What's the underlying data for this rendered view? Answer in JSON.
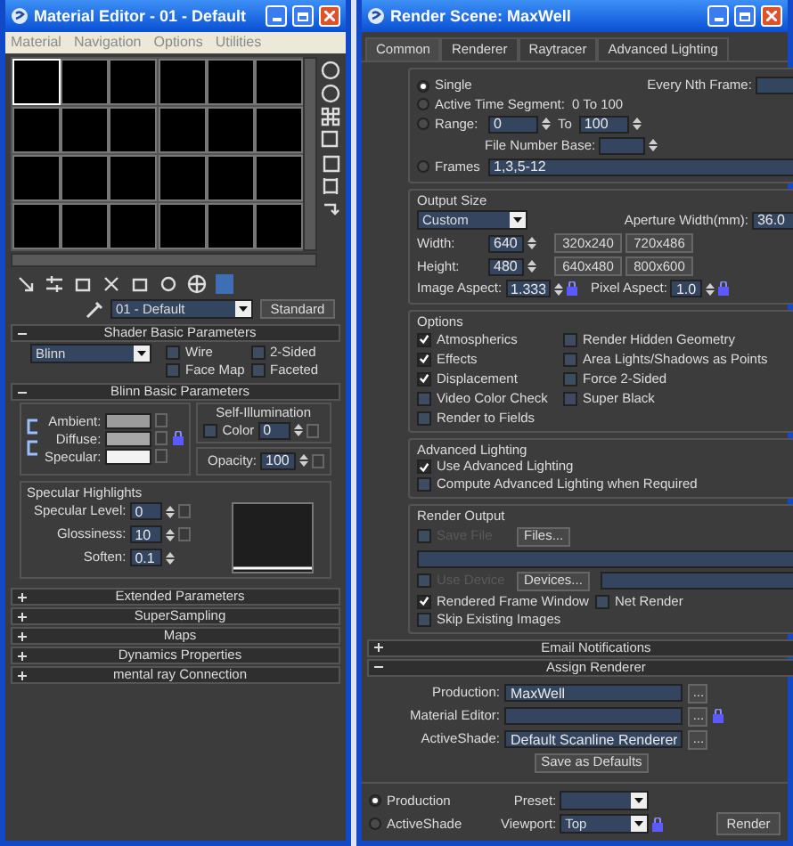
{
  "material_editor": {
    "title": "Material Editor - 01 - Default",
    "menu": [
      "Material",
      "Navigation",
      "Options",
      "Utilities"
    ],
    "slots": [
      {
        "selected": true
      },
      {
        "selected": false
      },
      {
        "selected": false
      },
      {
        "selected": false
      },
      {
        "selected": false
      },
      {
        "selected": false
      },
      {
        "selected": false
      },
      {
        "selected": false
      },
      {
        "selected": false
      },
      {
        "selected": false
      },
      {
        "selected": false
      },
      {
        "selected": false
      },
      {
        "selected": false
      },
      {
        "selected": false
      },
      {
        "selected": false
      },
      {
        "selected": false
      },
      {
        "selected": false
      },
      {
        "selected": false
      },
      {
        "selected": false
      },
      {
        "selected": false
      },
      {
        "selected": false
      },
      {
        "selected": false
      },
      {
        "selected": false
      },
      {
        "selected": false
      }
    ],
    "material_name": "01 - Default",
    "material_type": "Standard",
    "shader_rollout": {
      "title": "Shader Basic Parameters",
      "expanded": true,
      "shader": "Blinn",
      "options": [
        {
          "label": "Wire",
          "checked": false
        },
        {
          "label": "2-Sided",
          "checked": false
        },
        {
          "label": "Face Map",
          "checked": false
        },
        {
          "label": "Faceted",
          "checked": false
        }
      ]
    },
    "blinn_rollout": {
      "title": "Blinn Basic Parameters",
      "expanded": true,
      "colors": [
        {
          "label": "Ambient:",
          "color": "#9c9c9c"
        },
        {
          "label": "Diffuse:",
          "color": "#a6a6a6"
        },
        {
          "label": "Specular:",
          "color": "#f2f2f2"
        }
      ],
      "self_illumination": {
        "title": "Self-Illumination",
        "label": "Color",
        "value": "0",
        "checked": false
      },
      "opacity": {
        "label": "Opacity:",
        "value": "100"
      },
      "specular_highlights": {
        "title": "Specular Highlights",
        "fields": [
          {
            "label": "Specular Level:",
            "value": "0"
          },
          {
            "label": "Glossiness:",
            "value": "10"
          },
          {
            "label": "Soften:",
            "value": "0.1"
          }
        ]
      }
    },
    "collapsed_rollouts": [
      {
        "title": "Extended Parameters",
        "expanded": false
      },
      {
        "title": "SuperSampling",
        "expanded": false
      },
      {
        "title": "Maps",
        "expanded": false
      },
      {
        "title": "Dynamics Properties",
        "expanded": false
      },
      {
        "title": "mental ray Connection",
        "expanded": false
      }
    ]
  },
  "render_scene": {
    "title": "Render Scene: MaxWell",
    "tabs": [
      {
        "label": "Common",
        "selected": true
      },
      {
        "label": "Renderer",
        "selected": false
      },
      {
        "label": "Raytracer",
        "selected": false
      },
      {
        "label": "Advanced Lighting",
        "selected": false
      }
    ],
    "time_output": {
      "modes": [
        {
          "label": "Single",
          "selected": true
        },
        {
          "label": "Active Time Segment:",
          "selected": false
        },
        {
          "label": "Range:",
          "selected": false
        },
        {
          "label": "Frames",
          "selected": false
        }
      ],
      "every_nth_frame": {
        "label": "Every Nth Frame:"
      },
      "active_time_segment": "0 To 100",
      "range": {
        "from": "0",
        "to_label": "To",
        "to": "100"
      },
      "file_number_base": {
        "label": "File Number Base:"
      },
      "frames": "1,3,5-12"
    },
    "output_size": {
      "title": "Output Size",
      "preset": "Custom",
      "aperture": {
        "label": "Aperture Width(mm):",
        "value": "36.0"
      },
      "width": {
        "label": "Width:",
        "value": "640"
      },
      "height": {
        "label": "Height:",
        "value": "480"
      },
      "presets": [
        "320x240",
        "720x486",
        "640x480",
        "800x600"
      ],
      "image_aspect": {
        "label": "Image Aspect:",
        "value": "1.333"
      },
      "pixel_aspect": {
        "label": "Pixel Aspect:",
        "value": "1.0"
      }
    },
    "options": {
      "title": "Options",
      "items": [
        {
          "label": "Atmospherics",
          "checked": true
        },
        {
          "label": "Render Hidden Geometry",
          "checked": false
        },
        {
          "label": "Effects",
          "checked": true
        },
        {
          "label": "Area Lights/Shadows as Points",
          "checked": false
        },
        {
          "label": "Displacement",
          "checked": true
        },
        {
          "label": "Force 2-Sided",
          "checked": false
        },
        {
          "label": "Video Color Check",
          "checked": false
        },
        {
          "label": "Super Black",
          "checked": false
        },
        {
          "label": "Render to Fields",
          "checked": false
        }
      ]
    },
    "advanced_lighting": {
      "title": "Advanced Lighting",
      "items": [
        {
          "label": "Use Advanced Lighting",
          "checked": true
        },
        {
          "label": "Compute Advanced Lighting when Required",
          "checked": false
        }
      ]
    },
    "render_output": {
      "title": "Render Output",
      "save_file": {
        "label": "Save File",
        "checked": false,
        "disabled": true
      },
      "files_button": "Files...",
      "use_device": {
        "label": "Use Device",
        "checked": false,
        "disabled": true
      },
      "devices_button": "Devices...",
      "items": [
        {
          "label": "Rendered Frame Window",
          "checked": true
        },
        {
          "label": "Net Render",
          "checked": false
        },
        {
          "label": "Skip Existing Images",
          "checked": false
        }
      ]
    },
    "email_rollout": {
      "title": "Email Notifications",
      "expanded": false
    },
    "assign_rollout": {
      "title": "Assign Renderer",
      "expanded": true,
      "rows": [
        {
          "label": "Production:",
          "value": "MaxWell",
          "browse": "..."
        },
        {
          "label": "Material Editor:",
          "browse": "..."
        },
        {
          "label": "ActiveShade:",
          "value": "Default Scanline Renderer",
          "browse": "..."
        }
      ],
      "save_defaults": "Save as Defaults"
    },
    "footer": {
      "modes": [
        {
          "label": "Production",
          "selected": true
        },
        {
          "label": "ActiveShade",
          "selected": false
        }
      ],
      "preset": {
        "label": "Preset:"
      },
      "viewport": {
        "label": "Viewport:",
        "value": "Top"
      },
      "render_button": "Render"
    }
  }
}
